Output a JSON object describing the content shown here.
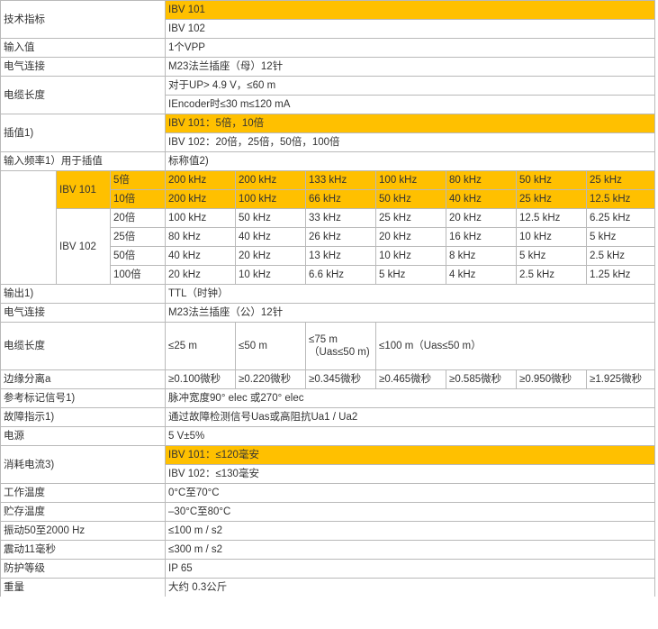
{
  "spec": {
    "header": {
      "label": "技术指标",
      "models": [
        "IBV 101",
        "IBV 102"
      ]
    },
    "input_value": {
      "label": "输入值",
      "value": "1个VPP"
    },
    "electrical_connection_in": {
      "label": "电气连接",
      "value": "M23法兰插座（母）12针"
    },
    "cable_length_in": {
      "label": "电缆长度",
      "lines": [
        "对于UP> 4.9 V，≤60 m",
        "IEncoder时≤30 m≤120 mA"
      ]
    },
    "interpolation": {
      "label": "插值1)",
      "lines": [
        "IBV 101：5倍，10倍",
        "IBV 102：20倍，25倍，50倍，100倍"
      ]
    },
    "input_freq": {
      "label": "输入频率1）用于插值",
      "nominal": "标称值2)",
      "groups": [
        {
          "model": "IBV 101",
          "rows": [
            {
              "factor": "5倍",
              "values": [
                "200 kHz",
                "200 kHz",
                "133 kHz",
                "100 kHz",
                "80 kHz",
                "50 kHz",
                "25 kHz"
              ]
            },
            {
              "factor": "10倍",
              "values": [
                "200 kHz",
                "100 kHz",
                "66 kHz",
                "50 kHz",
                "40 kHz",
                "25 kHz",
                "12.5 kHz"
              ]
            }
          ]
        },
        {
          "model": "IBV 102",
          "rows": [
            {
              "factor": "20倍",
              "values": [
                "100 kHz",
                "50 kHz",
                "33 kHz",
                "25 kHz",
                "20 kHz",
                "12.5 kHz",
                "6.25 kHz"
              ]
            },
            {
              "factor": "25倍",
              "values": [
                "80 kHz",
                "40 kHz",
                "26 kHz",
                "20 kHz",
                "16 kHz",
                "10 kHz",
                "5 kHz"
              ]
            },
            {
              "factor": "50倍",
              "values": [
                "40 kHz",
                "20 kHz",
                "13 kHz",
                "10 kHz",
                "8 kHz",
                "5 kHz",
                "2.5 kHz"
              ]
            },
            {
              "factor": "100倍",
              "values": [
                "20 kHz",
                "10 kHz",
                "6.6 kHz",
                "5 kHz",
                "4 kHz",
                "2.5 kHz",
                "1.25 kHz"
              ]
            }
          ]
        }
      ]
    },
    "output": {
      "label": "输出1)",
      "value": "TTL（时钟）"
    },
    "electrical_connection_out": {
      "label": "电气连接",
      "value": "M23法兰插座（公）12针"
    },
    "cable_length_out": {
      "label": "电缆长度",
      "values": [
        "≤25 m",
        "≤50 m",
        "≤75 m（Uas≤50 m)",
        "≤100 m（Uas≤50 m）"
      ]
    },
    "edge_separation": {
      "label": "边缘分离a",
      "values": [
        "≥0.100微秒",
        "≥0.220微秒",
        "≥0.345微秒",
        "≥0.465微秒",
        "≥0.585微秒",
        "≥0.950微秒",
        "≥1.925微秒"
      ]
    },
    "reference_mark": {
      "label": "参考标记信号1)",
      "value": "脉冲宽度90° elec 或270° elec"
    },
    "fault_indication": {
      "label": "故障指示1)",
      "value": "通过故障检测信号Uas或高阻抗Ua1 / Ua2"
    },
    "power_supply": {
      "label": "电源",
      "value": "5 V±5%"
    },
    "current_consumption": {
      "label": "消耗电流3)",
      "lines": [
        "IBV 101：≤120毫安",
        "IBV 102：≤130毫安"
      ]
    },
    "operating_temp": {
      "label": "工作温度",
      "value": "0°C至70°C"
    },
    "storage_temp": {
      "label": "贮存温度",
      "value": "–30°C至80°C"
    },
    "vibration": {
      "label": "振动50至2000 Hz",
      "value": "≤100 m / s2"
    },
    "shock": {
      "label": "震动11毫秒",
      "value": "≤300 m / s2"
    },
    "protection": {
      "label": "防护等级",
      "value": "IP 65"
    },
    "weight": {
      "label": "重量",
      "value": "大约 0.3公斤"
    }
  },
  "colors": {
    "highlight": "#ffc000",
    "border": "#b9b9b9",
    "text": "#333333"
  }
}
